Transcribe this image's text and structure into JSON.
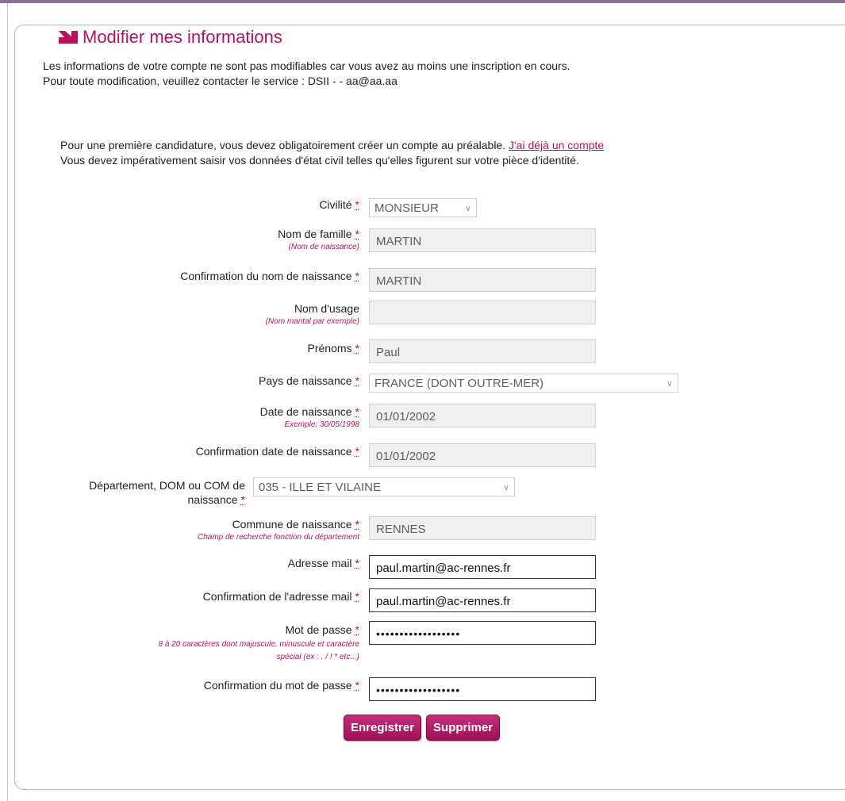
{
  "page": {
    "title": "Modifier mes informations",
    "info_line1": "Les informations de votre compte ne sont pas modifiables car vous avez au moins une inscription en cours.",
    "info_line2": "Pour toute modification, veuillez contacter le service : DSII - - aa@aa.aa",
    "intro_line1": "Pour une première candidature, vous devez obligatoirement créer un compte au préalable.",
    "intro_link": "J'ai déjà un compte",
    "intro_line2": "Vous devez impérativement saisir vos données d'état civil telles qu'elles figurent sur votre pièce d'identité.",
    "required_marker": "*",
    "accent_color": "#b8125f"
  },
  "form": {
    "civilite": {
      "label": "Civilité",
      "value": "MONSIEUR"
    },
    "nom_famille": {
      "label": "Nom de famille",
      "hint": "(Nom de naissance)",
      "value": "MARTIN"
    },
    "confirm_nom": {
      "label": "Confirmation du nom de naissance",
      "value": "MARTIN"
    },
    "nom_usage": {
      "label": "Nom d'usage",
      "hint": "(Nom marital par exemple)",
      "value": ""
    },
    "prenoms": {
      "label": "Prénoms",
      "value": "Paul"
    },
    "pays": {
      "label": "Pays de naissance",
      "value": "FRANCE (DONT OUTRE-MER)"
    },
    "date_naissance": {
      "label": "Date de naissance",
      "hint": "Exemple: 30/05/1998",
      "value": "01/01/2002"
    },
    "confirm_date": {
      "label": "Confirmation date de naissance",
      "value": "01/01/2002"
    },
    "departement": {
      "label_line1": "Département, DOM ou COM de",
      "label_line2": "naissance",
      "value": "035 - ILLE ET VILAINE"
    },
    "commune": {
      "label": "Commune de naissance",
      "hint": "Champ de recherche fonction du département",
      "value": "RENNES"
    },
    "email": {
      "label": "Adresse mail",
      "value": "paul.martin@ac-rennes.fr"
    },
    "confirm_email": {
      "label": "Confirmation de l'adresse mail",
      "value": "paul.martin@ac-rennes.fr"
    },
    "password": {
      "label": "Mot de passe",
      "hint_line1": "8 à 20 caractères dont majuscule, minuscule et caractère",
      "hint_line2": "spécial (ex : . / ! * etc...)",
      "value": "••••••••••••••••••"
    },
    "confirm_password": {
      "label": "Confirmation du mot de passe",
      "value": "••••••••••••••••••"
    }
  },
  "buttons": {
    "save": "Enregistrer",
    "delete": "Supprimer"
  }
}
